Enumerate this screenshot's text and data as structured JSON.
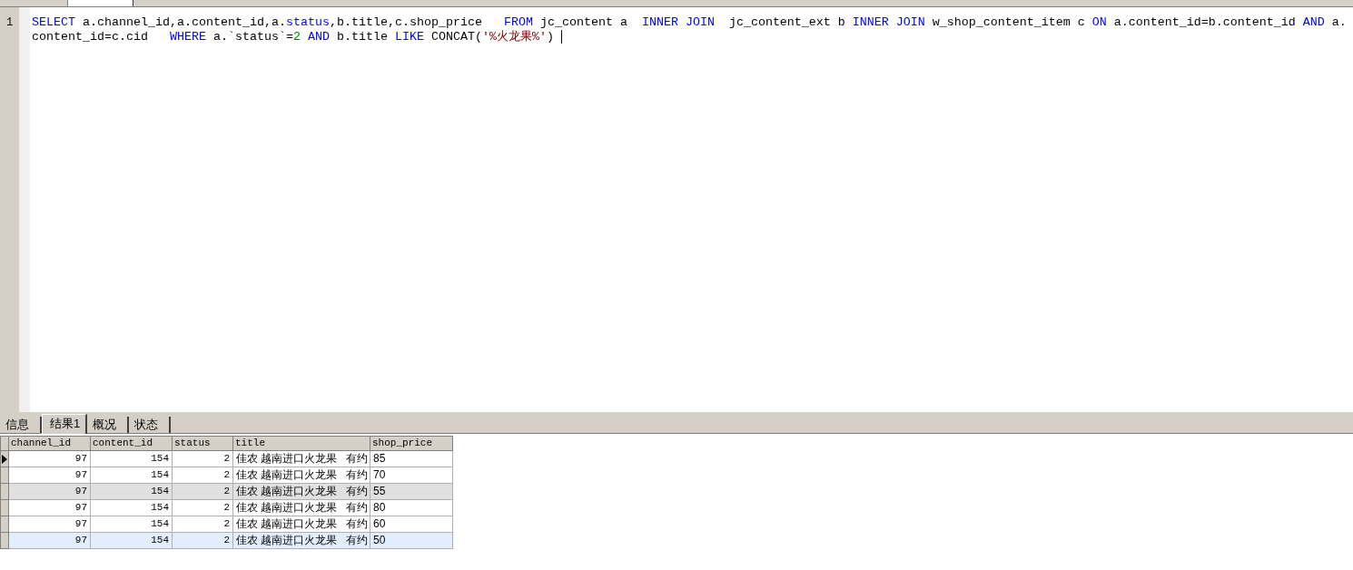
{
  "editor": {
    "line_numbers": [
      "1"
    ],
    "lines": [
      [
        {
          "kind": "keyword",
          "text": "SELECT"
        },
        {
          "kind": "plain",
          "text": " a.channel_id,a.content_id,a."
        },
        {
          "kind": "keyword",
          "text": "status"
        },
        {
          "kind": "plain",
          "text": ",b.title,c.shop_price   "
        },
        {
          "kind": "keyword",
          "text": "FROM"
        },
        {
          "kind": "plain",
          "text": " jc_content a  "
        },
        {
          "kind": "keyword",
          "text": "INNER JOIN"
        },
        {
          "kind": "plain",
          "text": "  jc_content_ext b "
        },
        {
          "kind": "keyword",
          "text": "INNER JOIN"
        },
        {
          "kind": "plain",
          "text": " w_shop_content_item c "
        },
        {
          "kind": "keyword",
          "text": "ON"
        },
        {
          "kind": "plain",
          "text": " a.content_id=b.content_id "
        },
        {
          "kind": "keyword",
          "text": "AND"
        },
        {
          "kind": "plain",
          "text": " a."
        }
      ],
      [
        {
          "kind": "plain",
          "text": "content_id=c.cid   "
        },
        {
          "kind": "keyword",
          "text": "WHERE"
        },
        {
          "kind": "plain",
          "text": " a.`status`="
        },
        {
          "kind": "number",
          "text": "2"
        },
        {
          "kind": "keyword",
          "text": " AND"
        },
        {
          "kind": "plain",
          "text": " b.title "
        },
        {
          "kind": "keyword",
          "text": "LIKE"
        },
        {
          "kind": "plain",
          "text": " CONCAT("
        },
        {
          "kind": "string",
          "text": "'%火龙果%'"
        },
        {
          "kind": "plain",
          "text": ")"
        }
      ]
    ]
  },
  "result_tabs": [
    {
      "label": "信息",
      "selected": false
    },
    {
      "label": "结果1",
      "selected": true
    },
    {
      "label": "概况",
      "selected": false
    },
    {
      "label": "状态",
      "selected": false
    }
  ],
  "table": {
    "columns": [
      "channel_id",
      "content_id",
      "status",
      "title",
      "shop_price"
    ],
    "rows": [
      {
        "cells": [
          "97",
          "154",
          "2",
          "佳农 越南进口火龙果   有约",
          "85"
        ],
        "current": true,
        "shaded": false,
        "selected": false
      },
      {
        "cells": [
          "97",
          "154",
          "2",
          "佳农 越南进口火龙果   有约",
          "70"
        ],
        "current": false,
        "shaded": false,
        "selected": false
      },
      {
        "cells": [
          "97",
          "154",
          "2",
          "佳农 越南进口火龙果   有约",
          "55"
        ],
        "current": false,
        "shaded": true,
        "selected": false
      },
      {
        "cells": [
          "97",
          "154",
          "2",
          "佳农 越南进口火龙果   有约",
          "80"
        ],
        "current": false,
        "shaded": false,
        "selected": false
      },
      {
        "cells": [
          "97",
          "154",
          "2",
          "佳农 越南进口火龙果   有约",
          "60"
        ],
        "current": false,
        "shaded": false,
        "selected": false
      },
      {
        "cells": [
          "97",
          "154",
          "2",
          "佳农 越南进口火龙果   有约",
          "50"
        ],
        "current": false,
        "shaded": false,
        "selected": true
      }
    ]
  }
}
